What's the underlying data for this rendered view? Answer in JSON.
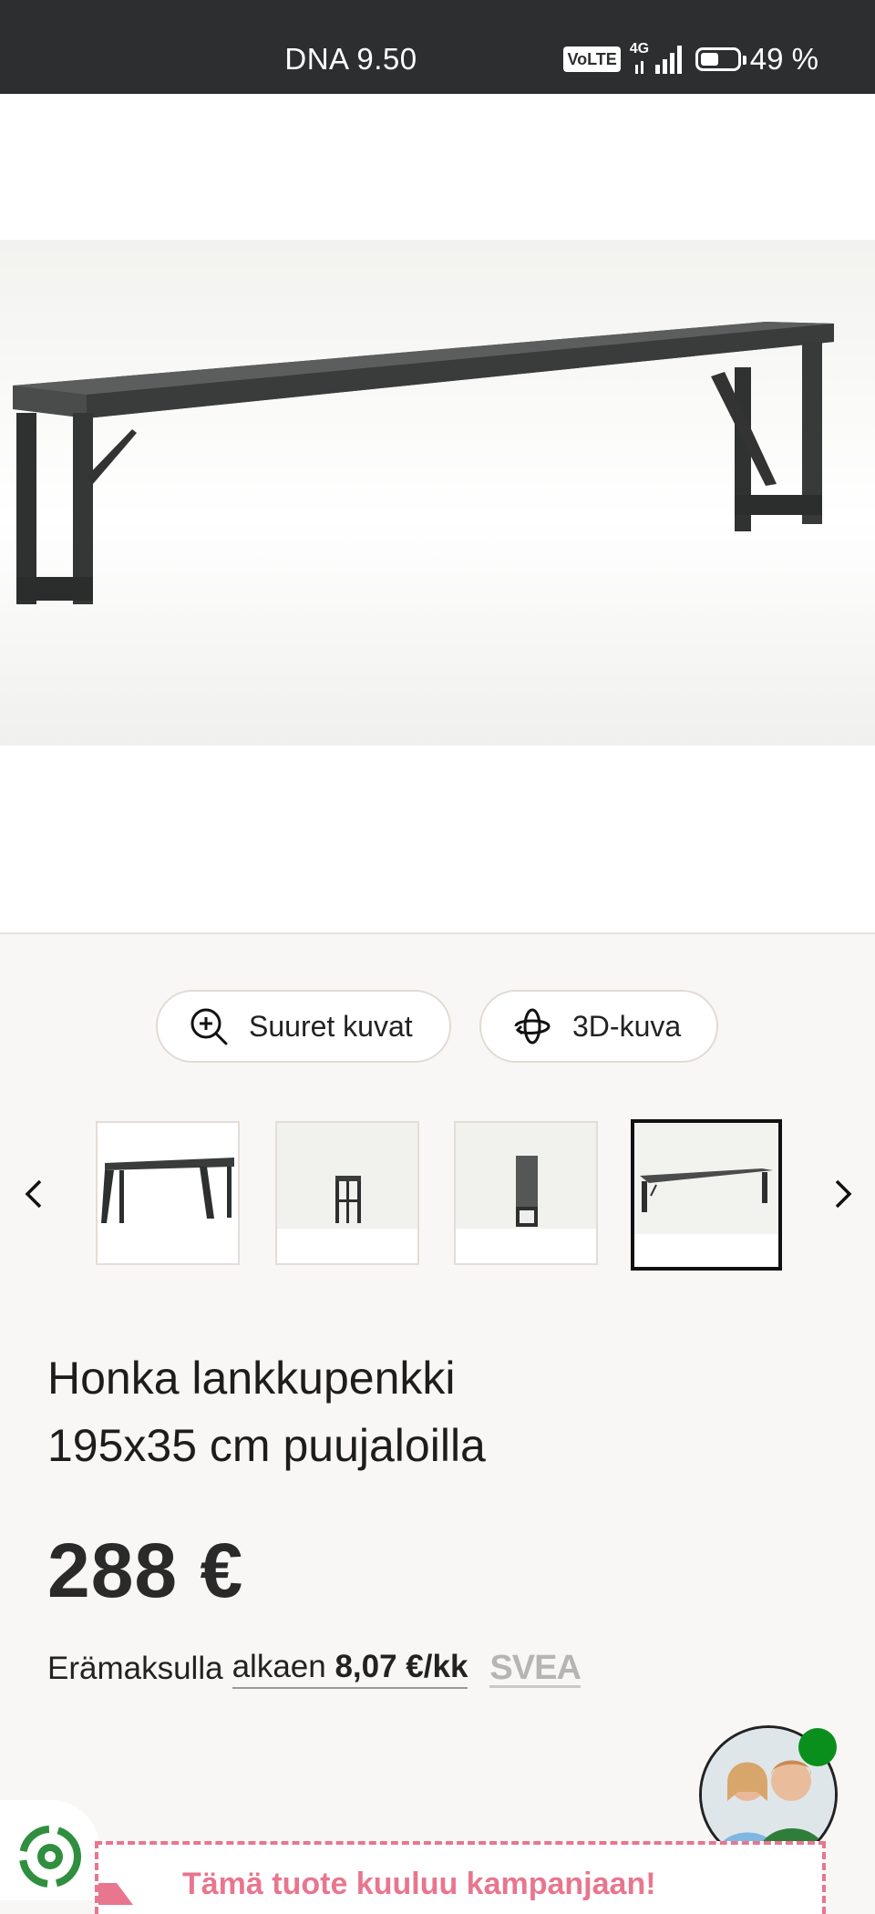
{
  "status_bar": {
    "time": "DNA 9.50",
    "volte": "VoLTE",
    "network": "4G",
    "battery_text": "49 %",
    "battery_level": 0.49
  },
  "gallery": {
    "zoom_button": "Suuret kuvat",
    "view3d_button": "3D-kuva",
    "thumbnails_count": 4,
    "active_thumbnail": 4
  },
  "product": {
    "title_line1": "Honka lankkupenkki",
    "title_line2": "195x35 cm puujaloilla",
    "price": "288 €"
  },
  "installment": {
    "prefix": "Erämaksulla",
    "link_text": "alkaen",
    "amount": "8,07 €/kk",
    "provider": "SVEA"
  },
  "campaign": {
    "text": "Tämä tuote kuuluu kampanjaan!"
  },
  "colors": {
    "status_bar": "#2d2e30",
    "accent_pink": "#e8768e",
    "online_green": "#0a8f1c"
  }
}
